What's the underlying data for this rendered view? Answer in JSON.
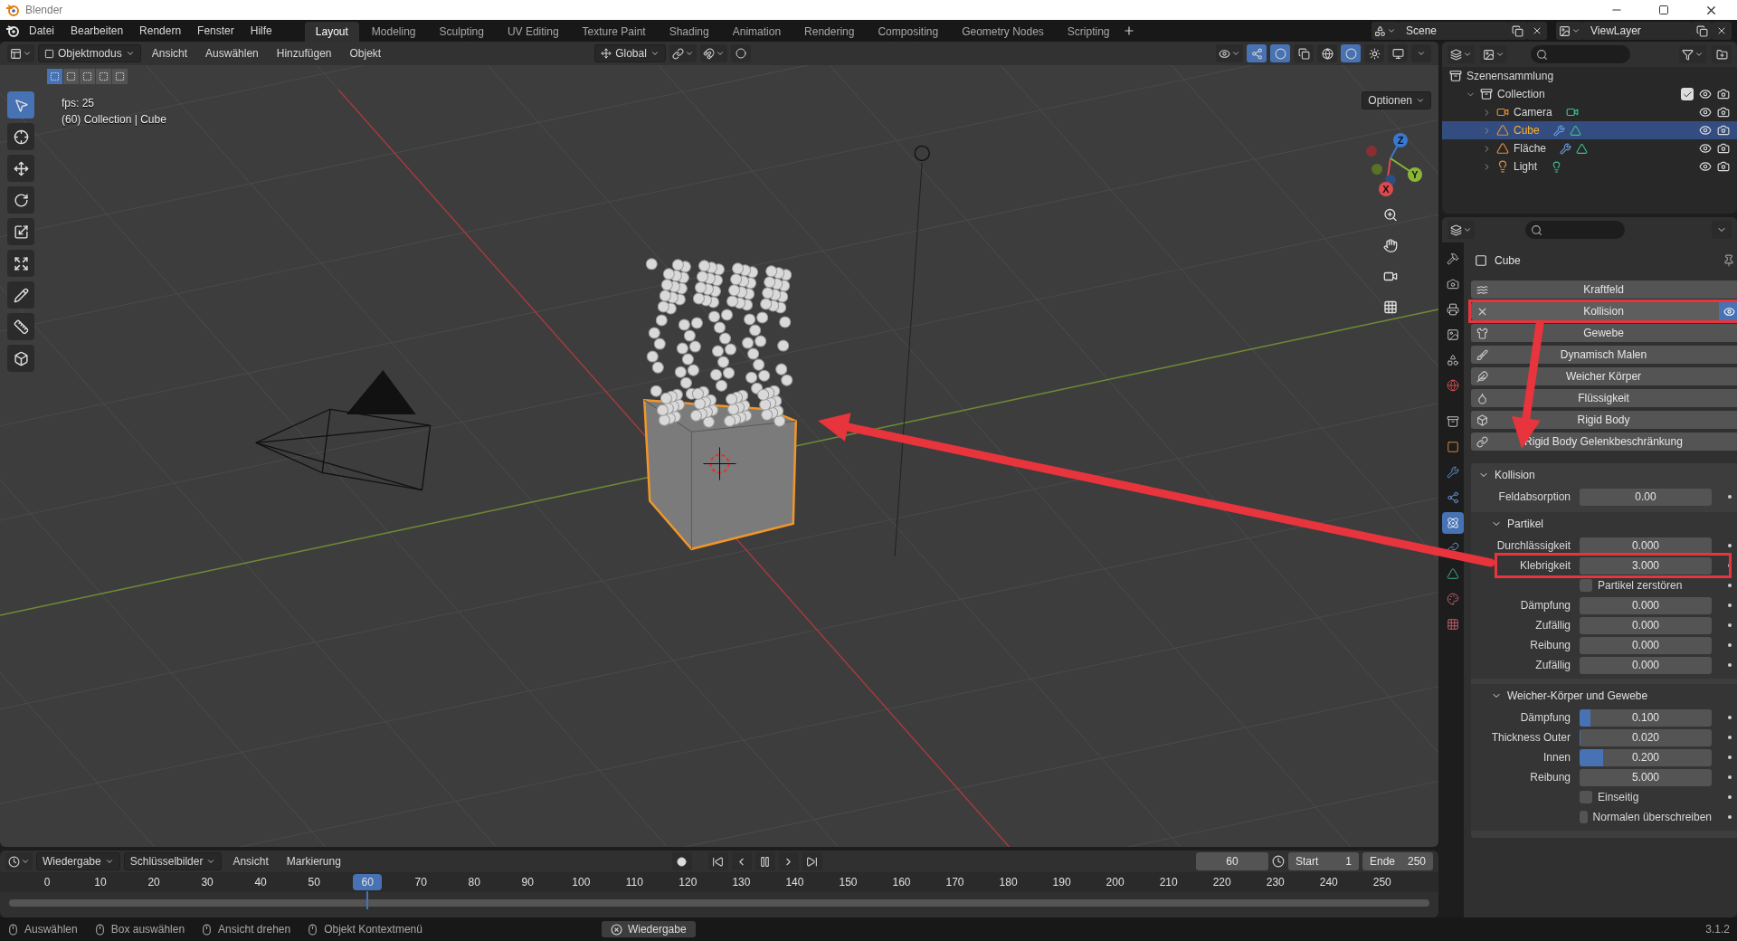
{
  "window": {
    "title": "Blender"
  },
  "menu": [
    "Datei",
    "Bearbeiten",
    "Rendern",
    "Fenster",
    "Hilfe"
  ],
  "workspaces": [
    {
      "label": "Layout",
      "selected": true
    },
    {
      "label": "Modeling",
      "selected": false
    },
    {
      "label": "Sculpting",
      "selected": false
    },
    {
      "label": "UV Editing",
      "selected": false
    },
    {
      "label": "Texture Paint",
      "selected": false
    },
    {
      "label": "Shading",
      "selected": false
    },
    {
      "label": "Animation",
      "selected": false
    },
    {
      "label": "Rendering",
      "selected": false
    },
    {
      "label": "Compositing",
      "selected": false
    },
    {
      "label": "Geometry Nodes",
      "selected": false
    },
    {
      "label": "Scripting",
      "selected": false
    }
  ],
  "scene": "Scene",
  "view_layer": "ViewLayer",
  "viewport": {
    "mode": "Objektmodus",
    "menus": [
      "Ansicht",
      "Auswählen",
      "Hinzufügen",
      "Objekt"
    ],
    "orientation": "Global",
    "options": "Optionen",
    "select_modes": [
      {
        "selected": true
      },
      {
        "selected": false
      },
      {
        "selected": false
      },
      {
        "selected": false
      },
      {
        "selected": false
      }
    ],
    "shading": [
      {
        "kind": "wireframe",
        "selected": false
      },
      {
        "kind": "solid",
        "selected": true
      },
      {
        "kind": "material",
        "selected": false
      },
      {
        "kind": "rendered",
        "selected": false
      }
    ],
    "tools": [
      {
        "kind": "select",
        "selected": true
      },
      {
        "kind": "cursor",
        "selected": false
      },
      {
        "kind": "move",
        "selected": false
      },
      {
        "kind": "rotate",
        "selected": false
      },
      {
        "kind": "scale",
        "selected": false
      },
      {
        "kind": "transform",
        "selected": false
      },
      {
        "kind": "annotate",
        "selected": false
      },
      {
        "kind": "measure",
        "selected": false
      },
      {
        "kind": "add",
        "selected": false
      }
    ],
    "fps": "fps: 25",
    "info": "(60) Collection | Cube",
    "gizmo_axes": [
      "X",
      "Y",
      "Z"
    ]
  },
  "outliner": {
    "root": "Szenensammlung",
    "collections": [
      {
        "label": "Collection",
        "expanded": true,
        "checked": true,
        "children": [
          {
            "label": "Camera",
            "kind": "camera",
            "expanded": false,
            "selected": false
          },
          {
            "label": "Cube",
            "kind": "mesh",
            "expanded": false,
            "selected": true
          },
          {
            "label": "Fläche",
            "kind": "mesh",
            "expanded": false,
            "selected": false
          },
          {
            "label": "Light",
            "kind": "light",
            "expanded": false,
            "selected": false
          }
        ]
      }
    ]
  },
  "properties": {
    "object": "Cube",
    "tabs": [
      {
        "kind": "tool",
        "selected": false
      },
      {
        "kind": "render",
        "selected": false
      },
      {
        "kind": "output",
        "selected": false
      },
      {
        "kind": "view_layer",
        "selected": false
      },
      {
        "kind": "scene",
        "selected": false
      },
      {
        "kind": "world",
        "selected": false
      },
      {
        "kind": "collection",
        "selected": false
      },
      {
        "kind": "object",
        "selected": false
      },
      {
        "kind": "modifiers",
        "selected": false
      },
      {
        "kind": "particles",
        "selected": false
      },
      {
        "kind": "physics",
        "selected": true
      },
      {
        "kind": "constraints",
        "selected": false
      },
      {
        "kind": "data",
        "selected": false
      },
      {
        "kind": "material",
        "selected": false
      },
      {
        "kind": "texture",
        "selected": false
      }
    ],
    "physics": [
      {
        "label": "Kraftfeld",
        "kind": "force",
        "enabled": false,
        "highlighted": false
      },
      {
        "label": "Kollision",
        "kind": "collision",
        "enabled": true,
        "highlighted": true
      },
      {
        "label": "Gewebe",
        "kind": "cloth",
        "enabled": false,
        "highlighted": false
      },
      {
        "label": "Dynamisch Malen",
        "kind": "paint",
        "enabled": false,
        "highlighted": false
      },
      {
        "label": "Weicher Körper",
        "kind": "softbody",
        "enabled": false,
        "highlighted": false
      },
      {
        "label": "Flüssigkeit",
        "kind": "fluid",
        "enabled": false,
        "highlighted": false
      },
      {
        "label": "Rigid Body",
        "kind": "rigid",
        "enabled": false,
        "highlighted": false
      },
      {
        "label": "Rigid Body Gelenkbeschränkung",
        "kind": "constraint",
        "enabled": false,
        "highlighted": false
      }
    ],
    "panel": {
      "title": "Kollision",
      "expanded": true,
      "rows": [
        {
          "kind": "number",
          "label": "Feldabsorption",
          "value": "0.00",
          "highlighted": false
        }
      ],
      "subpanels": [
        {
          "title": "Partikel",
          "expanded": true,
          "rows": [
            {
              "kind": "number",
              "label": "Durchlässigkeit",
              "value": "0.000",
              "highlighted": false
            },
            {
              "kind": "number",
              "label": "Klebrigkeit",
              "value": "3.000",
              "highlighted": true
            },
            {
              "kind": "check",
              "label": "Partikel zerstören",
              "checked": false
            },
            {
              "kind": "number",
              "label": "Dämpfung",
              "value": "0.000",
              "highlighted": false
            },
            {
              "kind": "number",
              "label": "Zufällig",
              "value": "0.000",
              "highlighted": false
            },
            {
              "kind": "number",
              "label": "Reibung",
              "value": "0.000",
              "highlighted": false
            },
            {
              "kind": "number",
              "label": "Zufällig",
              "value": "0.000",
              "highlighted": false
            }
          ]
        },
        {
          "title": "Weicher-Körper und Gewebe",
          "expanded": true,
          "rows": [
            {
              "kind": "number",
              "label": "Dämpfung",
              "value": "0.100",
              "level": 0.08,
              "highlighted": false
            },
            {
              "kind": "number",
              "label": "Thickness Outer",
              "value": "0.020",
              "level": 0.01,
              "highlighted": false
            },
            {
              "kind": "number",
              "label": "Innen",
              "value": "0.200",
              "level": 0.18,
              "highlighted": false
            },
            {
              "kind": "number",
              "label": "Reibung",
              "value": "5.000",
              "highlighted": false
            },
            {
              "kind": "check",
              "label": "Einseitig",
              "checked": false
            },
            {
              "kind": "check",
              "label": "Normalen überschreiben",
              "checked": false
            }
          ]
        }
      ]
    }
  },
  "timeline": {
    "menus": [
      "Wiedergabe",
      "Schlüsselbilder",
      "Ansicht",
      "Markierung"
    ],
    "frame": "60",
    "start_label": "Start",
    "start": "1",
    "end_label": "Ende",
    "end": "250",
    "ticks": [
      {
        "label": "0",
        "selected": false
      },
      {
        "label": "10",
        "selected": false
      },
      {
        "label": "20",
        "selected": false
      },
      {
        "label": "30",
        "selected": false
      },
      {
        "label": "40",
        "selected": false
      },
      {
        "label": "50",
        "selected": false
      },
      {
        "label": "60",
        "selected": true
      },
      {
        "label": "70",
        "selected": false
      },
      {
        "label": "80",
        "selected": false
      },
      {
        "label": "90",
        "selected": false
      },
      {
        "label": "100",
        "selected": false
      },
      {
        "label": "110",
        "selected": false
      },
      {
        "label": "120",
        "selected": false
      },
      {
        "label": "130",
        "selected": false
      },
      {
        "label": "140",
        "selected": false
      },
      {
        "label": "150",
        "selected": false
      },
      {
        "label": "160",
        "selected": false
      },
      {
        "label": "170",
        "selected": false
      },
      {
        "label": "180",
        "selected": false
      },
      {
        "label": "190",
        "selected": false
      },
      {
        "label": "200",
        "selected": false
      },
      {
        "label": "210",
        "selected": false
      },
      {
        "label": "220",
        "selected": false
      },
      {
        "label": "230",
        "selected": false
      },
      {
        "label": "240",
        "selected": false
      },
      {
        "label": "250",
        "selected": false
      }
    ]
  },
  "status": {
    "hints": [
      "Auswählen",
      "Box auswählen",
      "Ansicht drehen",
      "Objekt Kontextmenü"
    ],
    "playback": "Wiedergabe",
    "version": "3.1.2"
  }
}
